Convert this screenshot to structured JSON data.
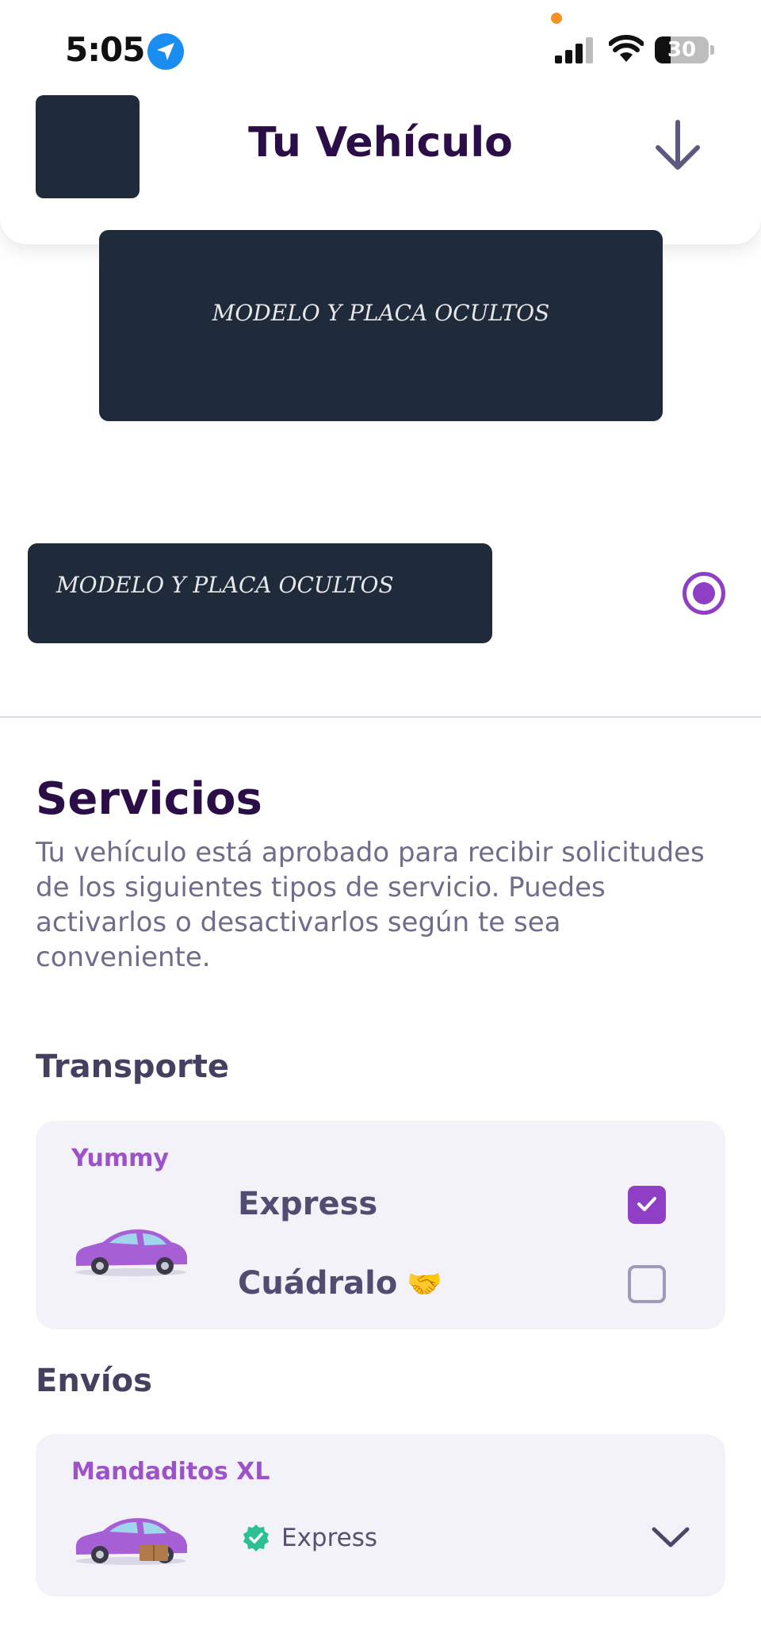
{
  "status_bar": {
    "time": "5:05",
    "battery": "30",
    "battery_level": 0.3
  },
  "header": {
    "title": "Tu Vehículo"
  },
  "vehicles": {
    "selected_text": "MODELO Y PLACA OCULTOS",
    "list": [
      {
        "text": "MODELO Y PLACA OCULTOS",
        "selected": true
      }
    ]
  },
  "services": {
    "title": "Servicios",
    "description": "Tu vehículo está aprobado para recibir solicitudes de los siguientes tipos de servicio. Puedes activarlos o desactivarlos según te sea conveniente.",
    "sections": [
      {
        "label": "Transporte",
        "brand": "Yummy",
        "options": [
          {
            "label": "Express",
            "checked": true
          },
          {
            "label": "Cuádralo",
            "checked": false
          }
        ]
      },
      {
        "label": "Envíos",
        "brand": "Mandaditos XL",
        "summary": "Express"
      }
    ]
  },
  "colors": {
    "accent": "#8e3fc6",
    "title": "#2b0e47",
    "card_bg": "#f3f2f8",
    "brand_text": "#9d52c9",
    "verified": "#2dbf95"
  }
}
